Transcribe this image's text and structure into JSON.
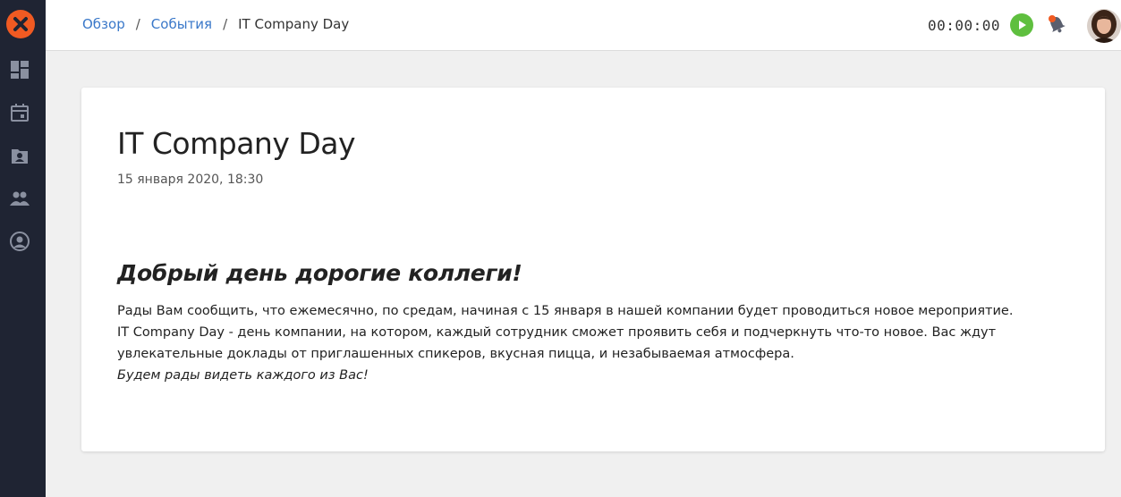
{
  "sidebar": {
    "logo_icon": "close-x-logo-icon",
    "items": [
      {
        "name": "dashboard",
        "icon": "dashboard-icon"
      },
      {
        "name": "events",
        "icon": "calendar-icon"
      },
      {
        "name": "contacts",
        "icon": "contact-folder-icon"
      },
      {
        "name": "people",
        "icon": "people-icon"
      },
      {
        "name": "profile",
        "icon": "user-circle-icon"
      }
    ],
    "colors": {
      "background": "#1f2433",
      "icon": "#8a90a0",
      "logo": "#f05a22"
    }
  },
  "header": {
    "breadcrumb": {
      "items": [
        "Обзор",
        "События"
      ],
      "separator": "/",
      "current": "IT Company Day"
    },
    "timer": "00:00:00",
    "play_icon": "play-icon",
    "notification_icon": "bell-icon",
    "avatar_icon": "user-avatar",
    "colors": {
      "link": "#3a78c9",
      "play": "#5fbf3f",
      "badge": "#f05a22"
    }
  },
  "event": {
    "title": "IT Company Day",
    "date": "15 января 2020, 18:30",
    "greeting": "Добрый день дорогие коллеги!",
    "paragraph_lines": [
      "Рады Вам сообщить, что ежемесячно, по средам, начиная с 15 января в нашей компании будет проводиться новое мероприятие.",
      "IT Company Day - день компании, на котором, каждый сотрудник сможет проявить себя и подчеркнуть что-то новое. Вас ждут",
      "увлекательные доклады от приглашенных спикеров, вкусная пицца, и незабываемая атмосфера."
    ],
    "closing": "Будем рады видеть каждого из Вас!"
  }
}
